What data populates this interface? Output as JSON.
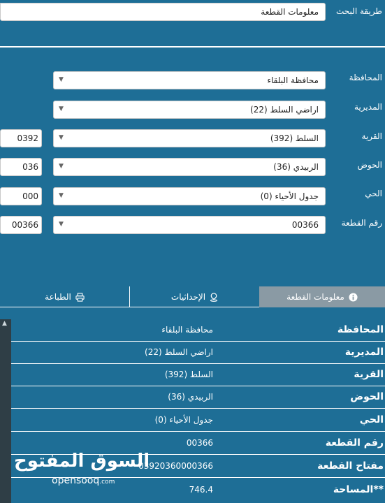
{
  "search": {
    "label": "طريقة البحث",
    "value": "معلومات القطعة"
  },
  "form": [
    {
      "label": "المحافظة",
      "value": "محافظة البلقاء",
      "code": ""
    },
    {
      "label": "المديرية",
      "value": "اراضي السلط (22)",
      "code": ""
    },
    {
      "label": "القرية",
      "value": "السلط (392)",
      "code": "0392"
    },
    {
      "label": "الحوض",
      "value": "الربيدي (36)",
      "code": "036"
    },
    {
      "label": "الحي",
      "value": "جدول الأحياء (0)",
      "code": "000"
    },
    {
      "label": "رقم القطعة",
      "value": "00366",
      "code": "00366"
    }
  ],
  "tabs": [
    {
      "label": "معلومات القطعة",
      "icon": "info-icon",
      "active": true
    },
    {
      "label": "الإحداثيات",
      "icon": "location-pin-icon",
      "active": false
    },
    {
      "label": "الطباعة",
      "icon": "printer-icon",
      "active": false
    }
  ],
  "details": [
    {
      "key": "المحافظة",
      "value": "محافظة البلقاء"
    },
    {
      "key": "المديرية",
      "value": "اراضي السلط (22)"
    },
    {
      "key": "القرية",
      "value": "السلط (392)"
    },
    {
      "key": "الحوض",
      "value": "الربيدي (36)"
    },
    {
      "key": "الحي",
      "value": "جدول الأحياء (0)"
    },
    {
      "key": "رقم القطعة",
      "value": "00366"
    },
    {
      "key": "مفتاح القطعة",
      "value": "03920360000366"
    },
    {
      "key": "المساحة**",
      "value": "746.4"
    }
  ],
  "watermark": {
    "arabic": "السوق المفتوح",
    "latin": "opensooq",
    "suffix": ".com"
  },
  "colors": {
    "background": "#1e6e96",
    "active_tab": "#8a9aa4",
    "scrollbar": "#2f3e46"
  }
}
